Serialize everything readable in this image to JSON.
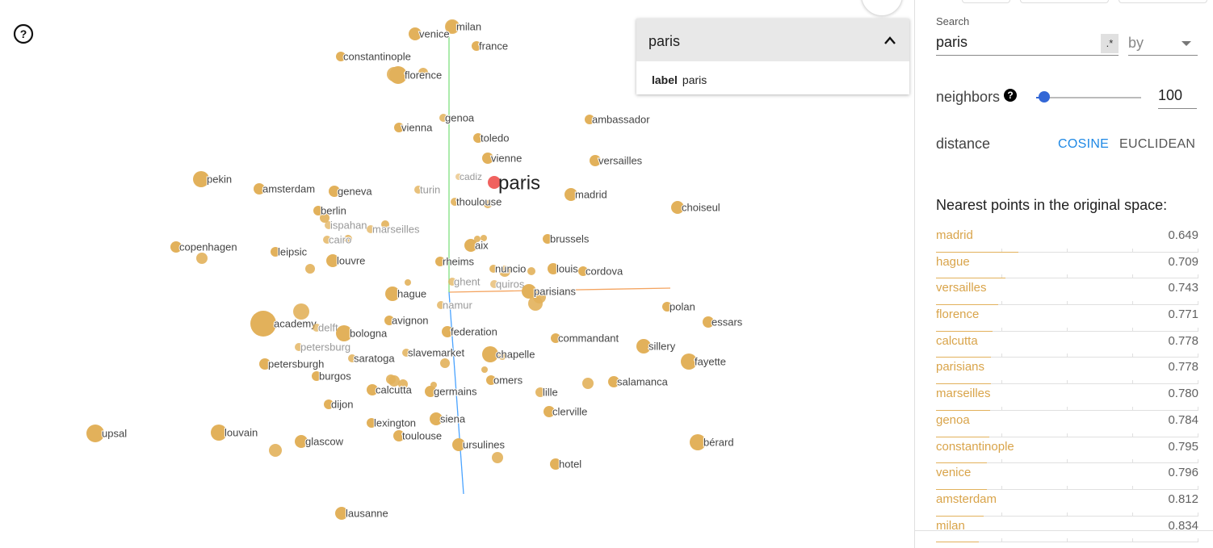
{
  "projector": {
    "selected_point": "paris",
    "axes_colors": {
      "x": "#f4a460",
      "y": "#7fe07f",
      "z": "#4aa3ff"
    },
    "point_color": "#e2b15b",
    "selected_color": "#f0625f",
    "points": [
      {
        "label": "milan"
      },
      {
        "label": "venice"
      },
      {
        "label": "france"
      },
      {
        "label": "constantinople"
      },
      {
        "label": "florence"
      },
      {
        "label": "genoa"
      },
      {
        "label": "vienna"
      },
      {
        "label": "toledo"
      },
      {
        "label": "ambassador"
      },
      {
        "label": "vienne"
      },
      {
        "label": "versailles"
      },
      {
        "label": "pekin"
      },
      {
        "label": "amsterdam"
      },
      {
        "label": "geneva"
      },
      {
        "label": "turin"
      },
      {
        "label": "cadiz"
      },
      {
        "label": "paris"
      },
      {
        "label": "madrid"
      },
      {
        "label": "thoulouse"
      },
      {
        "label": "choiseul"
      },
      {
        "label": "berlin"
      },
      {
        "label": "ispahan"
      },
      {
        "label": "marseilles"
      },
      {
        "label": "cairo"
      },
      {
        "label": "copenhagen"
      },
      {
        "label": "leipsic"
      },
      {
        "label": "aix"
      },
      {
        "label": "brussels"
      },
      {
        "label": "louvre"
      },
      {
        "label": "rheims"
      },
      {
        "label": "nuncio"
      },
      {
        "label": "louis"
      },
      {
        "label": "cordova"
      },
      {
        "label": "ghent"
      },
      {
        "label": "quiros"
      },
      {
        "label": "hague"
      },
      {
        "label": "parisians"
      },
      {
        "label": "namur"
      },
      {
        "label": "polan"
      },
      {
        "label": "academy"
      },
      {
        "label": "delft"
      },
      {
        "label": "avignon"
      },
      {
        "label": "bologna"
      },
      {
        "label": "federation"
      },
      {
        "label": "essars"
      },
      {
        "label": "commandant"
      },
      {
        "label": "petersburg"
      },
      {
        "label": "sillery"
      },
      {
        "label": "slavemarket"
      },
      {
        "label": "chapelle"
      },
      {
        "label": "saratoga"
      },
      {
        "label": "petersburgh"
      },
      {
        "label": "fayette"
      },
      {
        "label": "burgos"
      },
      {
        "label": "omers"
      },
      {
        "label": "salamanca"
      },
      {
        "label": "calcutta"
      },
      {
        "label": "germains"
      },
      {
        "label": "lille"
      },
      {
        "label": "dijon"
      },
      {
        "label": "clerville"
      },
      {
        "label": "lexington"
      },
      {
        "label": "siena"
      },
      {
        "label": "upsal"
      },
      {
        "label": "louvain"
      },
      {
        "label": "toulouse"
      },
      {
        "label": "glascow"
      },
      {
        "label": "ursulines"
      },
      {
        "label": "bérard"
      },
      {
        "label": "hotel"
      },
      {
        "label": "lausanne"
      }
    ]
  },
  "info_card": {
    "title": "paris",
    "field_name": "label",
    "field_value": "paris"
  },
  "panel": {
    "search_label": "Search",
    "search_value": "paris",
    "regex_label": ".*",
    "by_label": "by",
    "neighbors_label": "neighbors",
    "neighbors_help": "?",
    "neighbors_value": "100",
    "neighbors_slider_fraction": 0.08,
    "distance_label": "distance",
    "distance_cosine": "COSINE",
    "distance_euclidean": "EUCLIDEAN",
    "nearest_title": "Nearest points in the original space:",
    "nearest": [
      {
        "label": "madrid",
        "value": "0.649"
      },
      {
        "label": "hague",
        "value": "0.709"
      },
      {
        "label": "versailles",
        "value": "0.743"
      },
      {
        "label": "florence",
        "value": "0.771"
      },
      {
        "label": "calcutta",
        "value": "0.778"
      },
      {
        "label": "parisians",
        "value": "0.778"
      },
      {
        "label": "marseilles",
        "value": "0.780"
      },
      {
        "label": "genoa",
        "value": "0.784"
      },
      {
        "label": "constantinople",
        "value": "0.795"
      },
      {
        "label": "venice",
        "value": "0.796"
      },
      {
        "label": "amsterdam",
        "value": "0.812"
      },
      {
        "label": "milan",
        "value": "0.834"
      }
    ]
  }
}
